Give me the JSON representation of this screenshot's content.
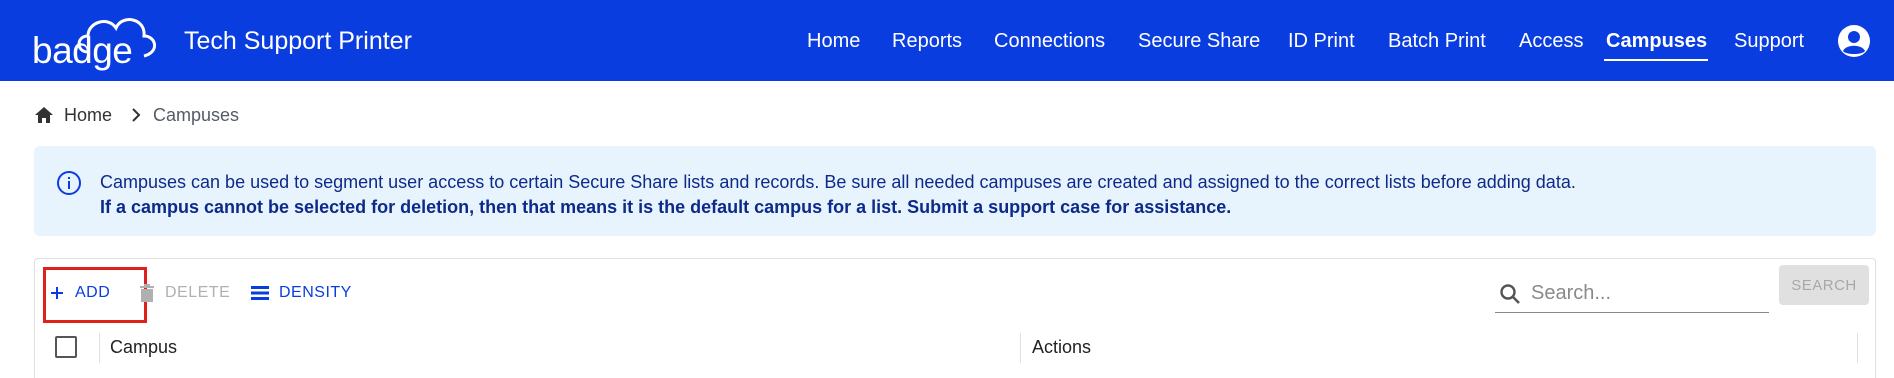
{
  "brand": {
    "logo_text": "badge",
    "app_title": "Tech Support Printer",
    "primary_color": "#0a3de0"
  },
  "nav": {
    "items": [
      {
        "label": "Home"
      },
      {
        "label": "Reports"
      },
      {
        "label": "Connections"
      },
      {
        "label": "Secure Share"
      },
      {
        "label": "ID Print"
      },
      {
        "label": "Batch Print"
      },
      {
        "label": "Access"
      },
      {
        "label": "Campuses",
        "active": true
      },
      {
        "label": "Support"
      }
    ],
    "account_icon": "account-circle-icon"
  },
  "breadcrumb": {
    "home_label": "Home",
    "current_label": "Campuses"
  },
  "alert": {
    "icon": "info-icon",
    "line1": "Campuses can be used to segment user access to certain Secure Share lists and records. Be sure all needed campuses are created and assigned to the correct lists before adding data.",
    "line2": "If a campus cannot be selected for deletion, then that means it is the default campus for a list. Submit a support case for assistance."
  },
  "toolbar": {
    "add_label": "ADD",
    "delete_label": "DELETE",
    "density_label": "DENSITY",
    "search_placeholder": "Search...",
    "search_button_label": "SEARCH",
    "highlight_color": "#e0201b"
  },
  "table": {
    "columns": [
      "Campus",
      "Actions"
    ]
  }
}
